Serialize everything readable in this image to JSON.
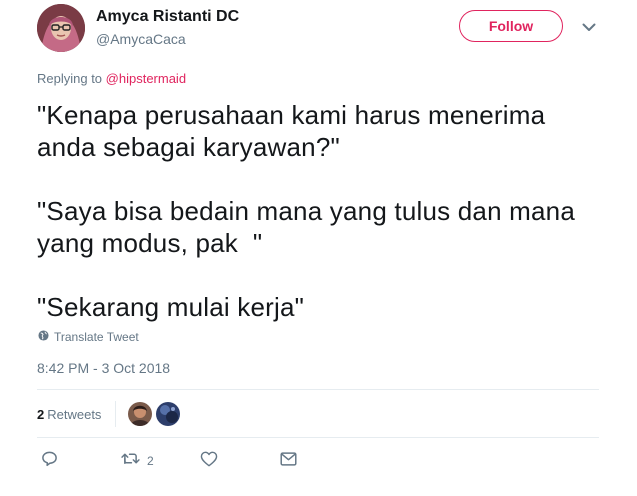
{
  "author": {
    "display_name": "Amyca Ristanti DC",
    "handle": "@AmycaCaca"
  },
  "follow_label": "Follow",
  "replying": {
    "prefix": "Replying to ",
    "mention": "@hipstermaid"
  },
  "tweet_text": {
    "paragraph_1": "\"Kenapa perusahaan kami harus menerima anda sebagai karyawan?\"",
    "paragraph_2": "\"Saya bisa bedain mana yang tulus dan mana yang modus, pak  \"",
    "paragraph_3": "\"Sekarang mulai kerja\""
  },
  "translate_label": "Translate Tweet",
  "timestamp": "8:42 PM - 3 Oct 2018",
  "stats": {
    "retweets_count": "2",
    "retweets_label": "Retweets"
  },
  "actions": {
    "retweet_count": "2"
  },
  "colors": {
    "accent": "#e0245e",
    "secondary_text": "#657786",
    "divider": "#e6ecf0"
  },
  "icons": [
    "globe-icon",
    "chevron-down-icon",
    "reply-icon",
    "retweet-icon",
    "like-icon",
    "direct-message-icon"
  ]
}
